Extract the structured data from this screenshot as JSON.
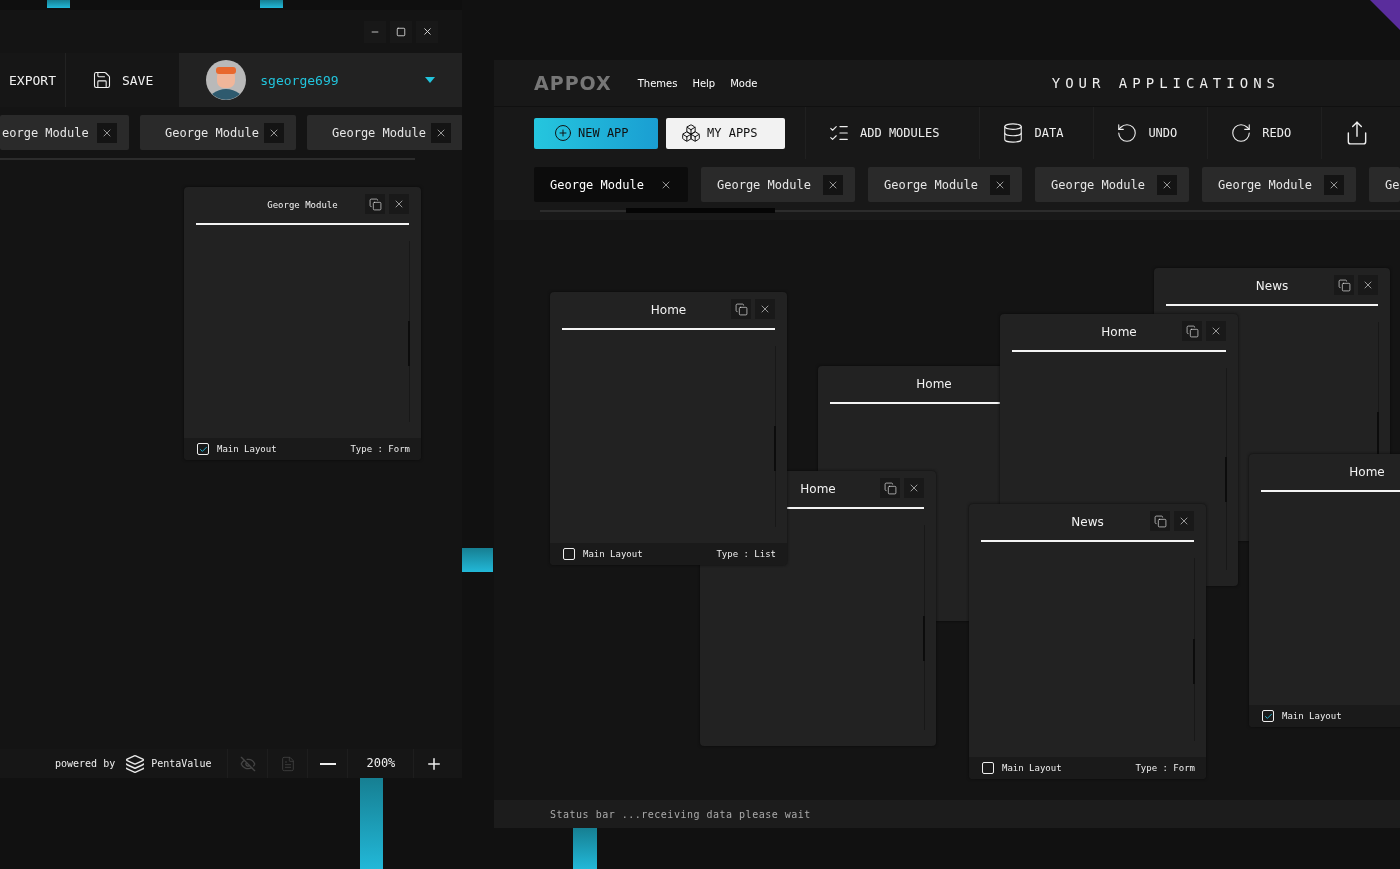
{
  "left_window": {
    "toolbar": {
      "export": "EXPORT",
      "save": "SAVE",
      "user": {
        "name": "sgeorge699"
      }
    },
    "tabs": [
      {
        "label": "eorge Module",
        "selected": false
      },
      {
        "label": "George Module",
        "selected": false
      },
      {
        "label": "George Module",
        "selected": false
      }
    ],
    "cards": [
      {
        "title": "George Module",
        "footer": {
          "label": "Main Layout",
          "checked": true,
          "type": "Type : Form"
        }
      }
    ],
    "bottom_bar": {
      "powered_by": "powered by",
      "brand": "PentaValue",
      "zoom": "200%"
    }
  },
  "app_window": {
    "logo": "APPOX",
    "menu": [
      "Themes",
      "Help",
      "Mode"
    ],
    "title": "YOUR APPLICATIONS",
    "toolbar": [
      {
        "kind": "primary",
        "label": "NEW APP"
      },
      {
        "kind": "secondary",
        "label": "MY APPS"
      },
      {
        "kind": "tool",
        "label": "ADD MODULES"
      },
      {
        "kind": "tool",
        "label": "DATA"
      },
      {
        "kind": "tool",
        "label": "UNDO"
      },
      {
        "kind": "tool",
        "label": "REDO"
      }
    ],
    "tabs": [
      {
        "label": "George Module",
        "selected": true
      },
      {
        "label": "George Module",
        "selected": false
      },
      {
        "label": "George Module",
        "selected": false
      },
      {
        "label": "George Module",
        "selected": false
      },
      {
        "label": "George Module",
        "selected": false
      },
      {
        "label": "Ge",
        "selected": false
      }
    ],
    "cards": [
      {
        "title": "Home"
      },
      {
        "title": "News"
      },
      {
        "title": "Home"
      },
      {
        "title": "Home"
      },
      {
        "title": "Home",
        "footer": {
          "label": "Main Layout",
          "checked": false,
          "type": "Type : List"
        }
      },
      {
        "title": "News",
        "footer": {
          "label": "Main Layout",
          "checked": false,
          "type": "Type : Form"
        }
      },
      {
        "title": "Home",
        "footer": {
          "label": "Main Layout",
          "checked": true
        }
      }
    ],
    "status_bar": "Status bar ...receiving data please wait"
  }
}
